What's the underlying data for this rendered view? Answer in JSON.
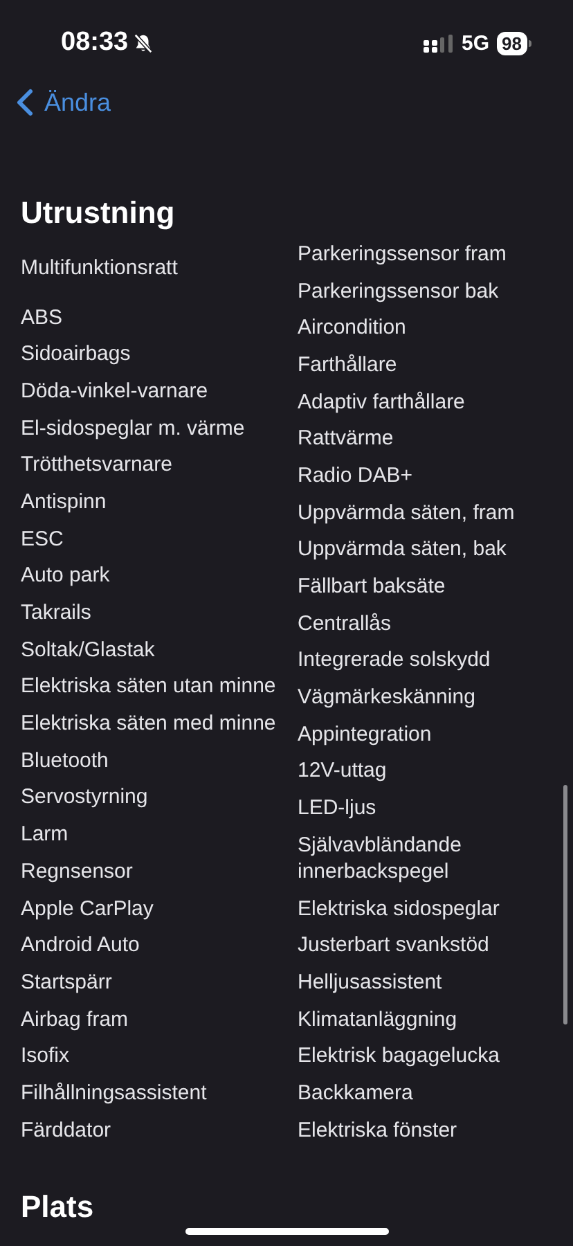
{
  "status_bar": {
    "time": "08:33",
    "network": "5G",
    "battery": "98"
  },
  "nav": {
    "back_label": "Ändra"
  },
  "sections": [
    {
      "title": "Utrustning",
      "columns": [
        [
          "Multifunktionsratt",
          "ABS",
          "Sidoairbags",
          "Döda-vinkel-varnare",
          "El-sidospeglar m. värme",
          "Trötthetsvarnare",
          "Antispinn",
          "ESC",
          "Auto park",
          "Takrails",
          "Soltak/Glastak",
          "Elektriska säten utan minne",
          "Elektriska säten med minne",
          "Bluetooth",
          "Servostyrning",
          "Larm",
          "Regnsensor",
          "Apple CarPlay",
          "Android Auto",
          "Startspärr",
          "Airbag fram",
          "Isofix",
          "Filhållningsassistent",
          "Färddator"
        ],
        [
          "Parkeringssensor fram",
          "Parkeringssensor bak",
          "Aircondition",
          "Farthållare",
          "Adaptiv farthållare",
          "Rattvärme",
          "Radio DAB+",
          "Uppvärmda säten, fram",
          "Uppvärmda säten, bak",
          "Fällbart baksäte",
          "Centrallås",
          "Integrerade solskydd",
          "Vägmärkeskänning",
          "Appintegration",
          "12V-uttag",
          "LED-ljus",
          "Självavbländande innerbackspegel",
          "Elektriska sidospeglar",
          "Justerbart svankstöd",
          "Helljusassistent",
          "Klimatanläggning",
          "Elektrisk bagagelucka",
          "Backkamera",
          "Elektriska fönster"
        ]
      ]
    },
    {
      "title": "Plats"
    }
  ]
}
